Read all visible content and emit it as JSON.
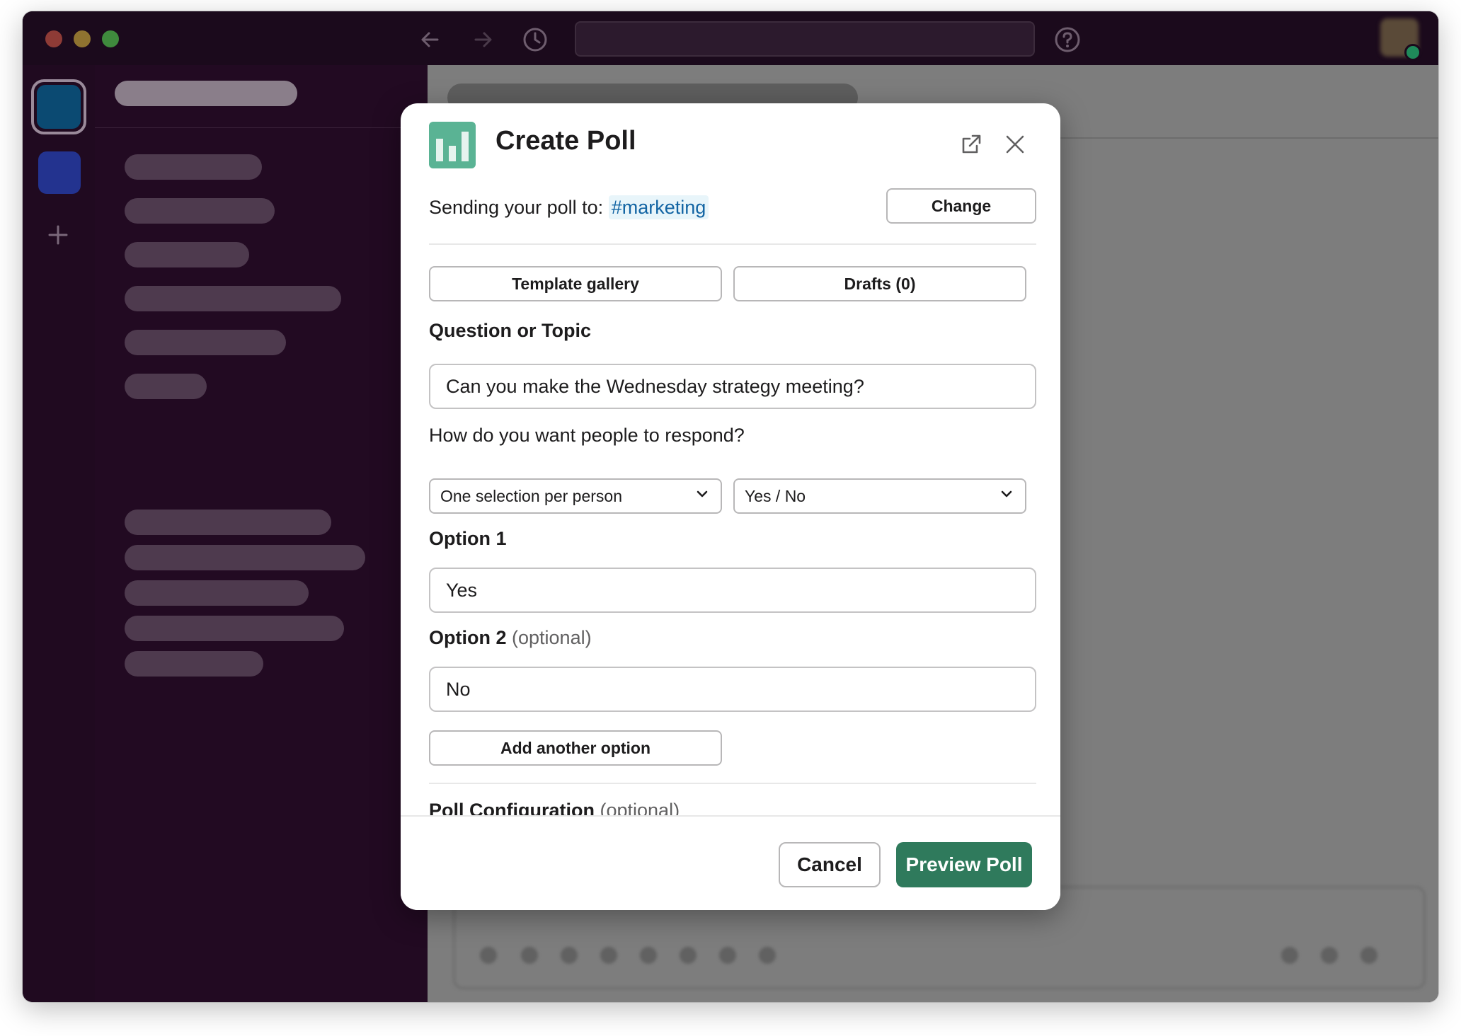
{
  "modal": {
    "title": "Create Poll",
    "sending_prefix": "Sending your poll to:",
    "channel": "#marketing",
    "change_label": "Change",
    "template_gallery_label": "Template gallery",
    "drafts_label": "Drafts (0)",
    "question_label": "Question or Topic",
    "question_value": "Can you make the Wednesday strategy meeting?",
    "respond_label": "How do you want people to respond?",
    "selection_mode": "One selection per person",
    "response_type": "Yes / No",
    "option1_label": "Option 1",
    "option1_value": "Yes",
    "option2_label": "Option 2",
    "option2_hint": "(optional)",
    "option2_value": "No",
    "add_option_label": "Add another option",
    "config_label": "Poll Configuration",
    "config_hint": "(optional)",
    "cancel_label": "Cancel",
    "preview_label": "Preview Poll"
  },
  "colors": {
    "sidebar_bg": "#220a22",
    "accent_green": "#2f7a5c",
    "channel_link": "#1264a3"
  },
  "icons": {
    "back": "arrow-left-icon",
    "forward": "arrow-right-icon",
    "history": "clock-icon",
    "help": "help-icon",
    "add_workspace": "plus-icon",
    "open_external": "external-link-icon",
    "close": "close-icon",
    "dropdown": "chevron-down-icon"
  }
}
